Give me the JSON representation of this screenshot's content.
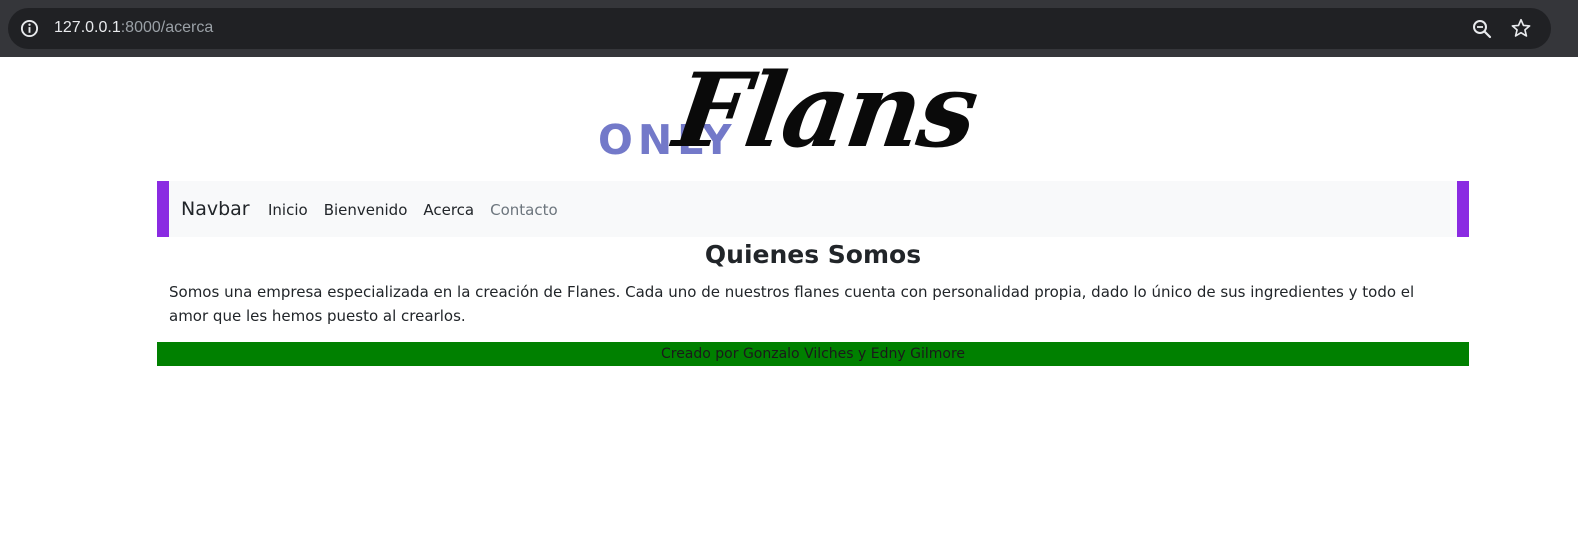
{
  "browser": {
    "url_host": "127.0.0.1",
    "url_path": ":8000/acerca",
    "icons": [
      "info-icon",
      "zoom-out-icon",
      "star-icon"
    ]
  },
  "logo": {
    "only_text": "ONLY",
    "flans_text": "Flans",
    "only_color": "#7379c9"
  },
  "navbar": {
    "brand": "Navbar",
    "accent_color": "#8a2be2",
    "links": [
      {
        "label": "Inicio",
        "muted": false
      },
      {
        "label": "Bienvenido",
        "muted": false
      },
      {
        "label": "Acerca",
        "muted": false
      },
      {
        "label": "Contacto",
        "muted": true
      }
    ]
  },
  "main": {
    "title": "Quienes Somos",
    "paragraph": "Somos una empresa especializada en la creación de Flanes. Cada uno de nuestros flanes cuenta con personalidad propia, dado lo único de sus ingredientes y todo el amor que les hemos puesto al crearlos."
  },
  "footer": {
    "text": "Creado por Gonzalo Vilches y Edny Gilmore",
    "background": "#008000"
  }
}
